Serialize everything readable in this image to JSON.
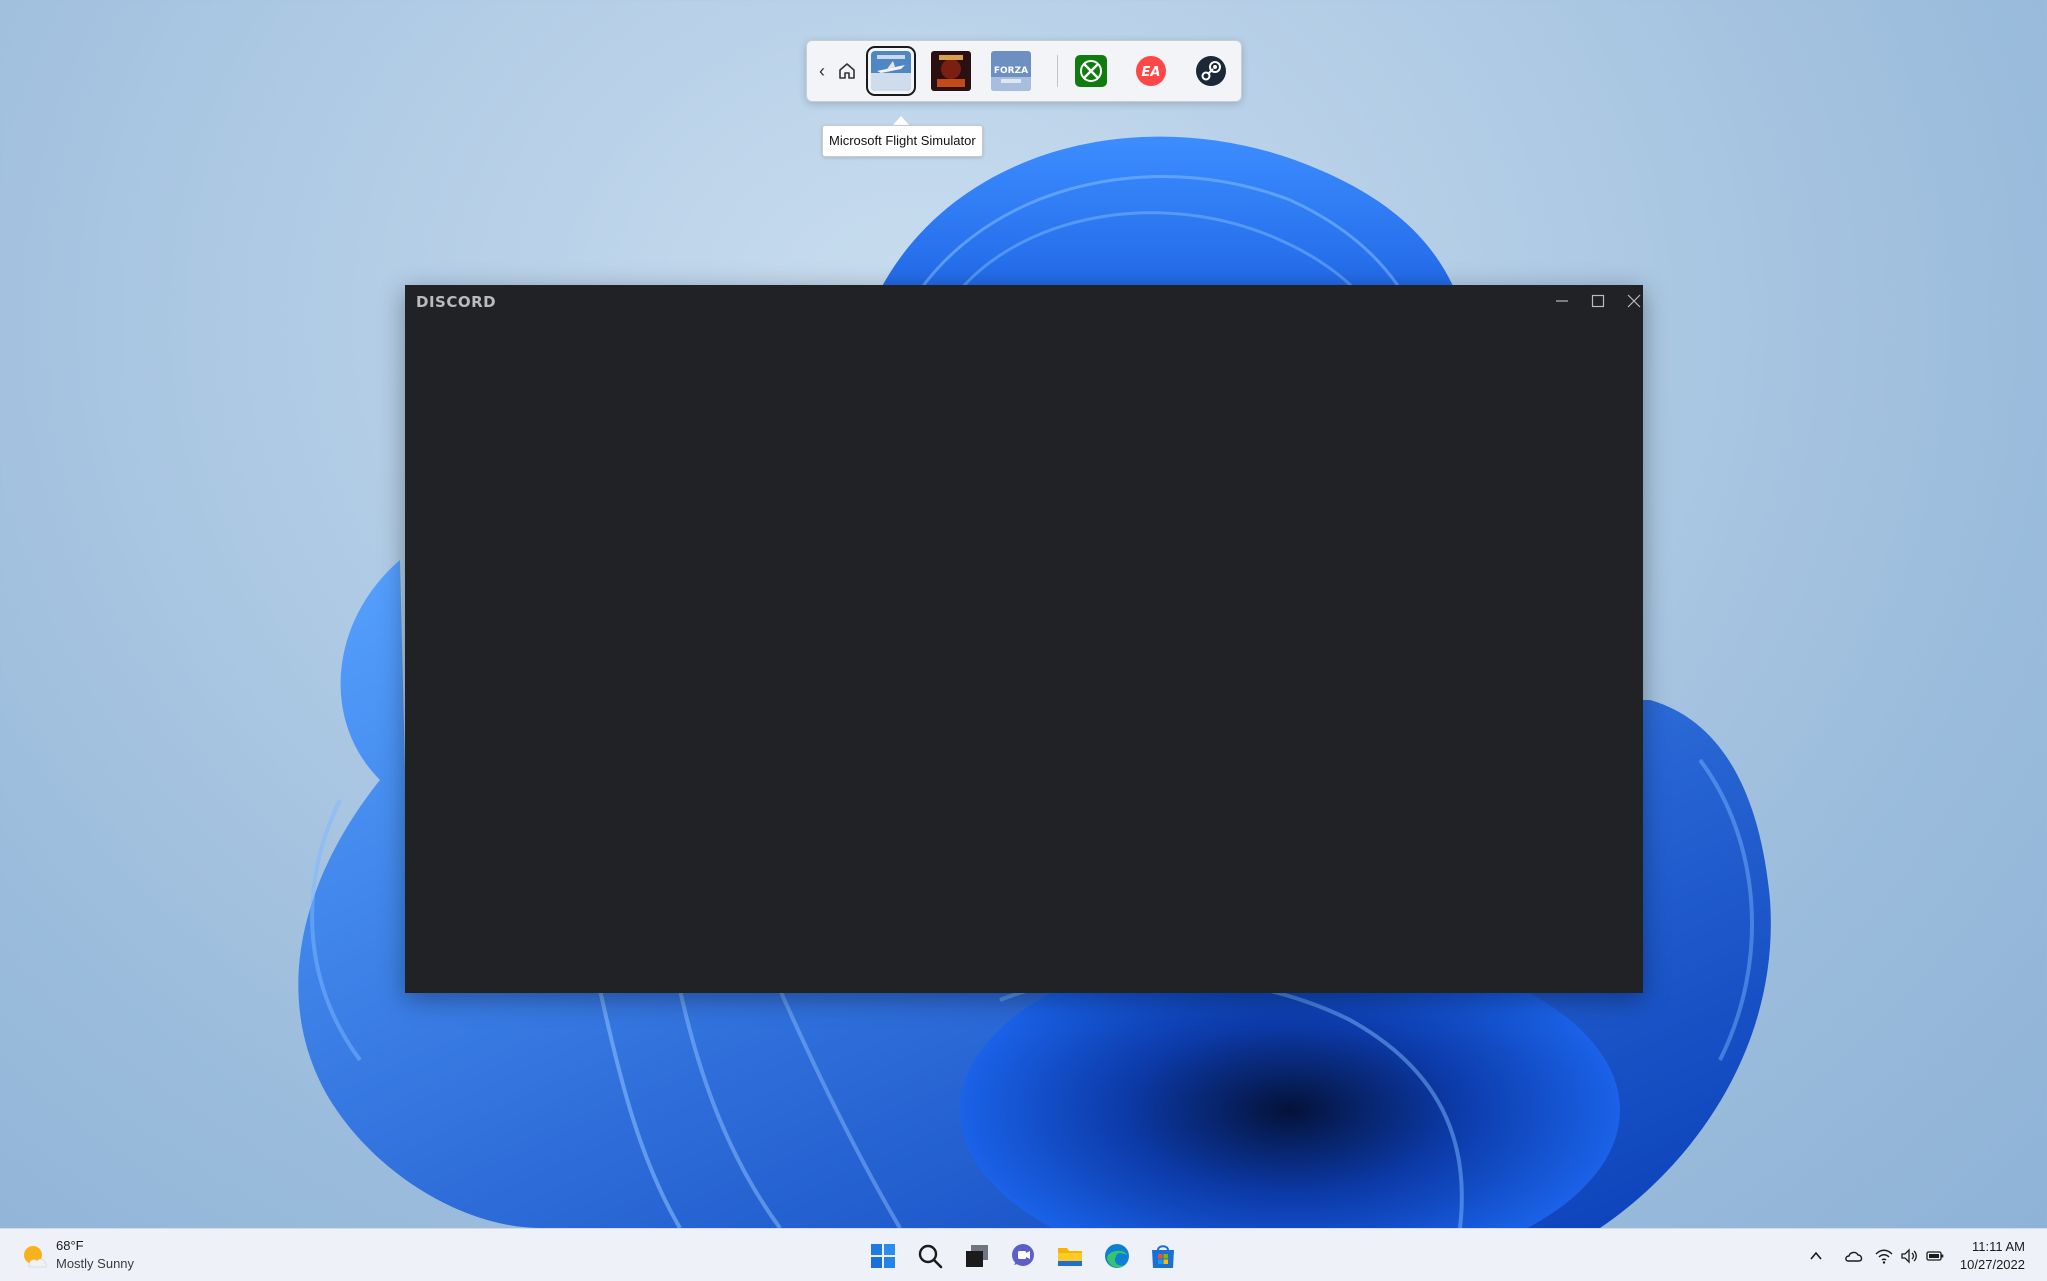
{
  "game_bar": {
    "tooltip": "Microsoft Flight Simulator",
    "games": [
      {
        "name": "Microsoft Flight Simulator",
        "icon": "flight-simulator-tile",
        "selected": true
      },
      {
        "name": "game-tile-2",
        "icon": "dark-game-tile",
        "selected": false
      },
      {
        "name": "game-tile-3",
        "icon": "forza-tile",
        "selected": false
      }
    ],
    "tile_texts": {
      "forza": "FORZA"
    },
    "launchers": [
      {
        "icon": "xbox-icon",
        "color": "#107c10"
      },
      {
        "icon": "ea-icon",
        "label": "EA",
        "color": "#ff4747"
      },
      {
        "icon": "steam-icon",
        "color": "#1b2838"
      }
    ]
  },
  "discord_window": {
    "title": "DISCORD",
    "background": "#202225",
    "controls": [
      "minimize-icon",
      "maximize-icon",
      "close-icon"
    ]
  },
  "taskbar": {
    "weather": {
      "temp": "68°F",
      "desc": "Mostly Sunny"
    },
    "apps": [
      "start-icon",
      "search-icon",
      "task-view-icon",
      "chat-icon",
      "file-explorer-icon",
      "edge-icon",
      "store-icon"
    ],
    "tray": [
      "chevron-up-icon",
      "onedrive-icon",
      "wifi-icon",
      "volume-icon",
      "battery-icon"
    ],
    "clock": {
      "time": "11:11 AM",
      "date": "10/27/2022"
    }
  },
  "colors": {
    "accent": "#0067c0",
    "bloom": "#1a6fef"
  }
}
